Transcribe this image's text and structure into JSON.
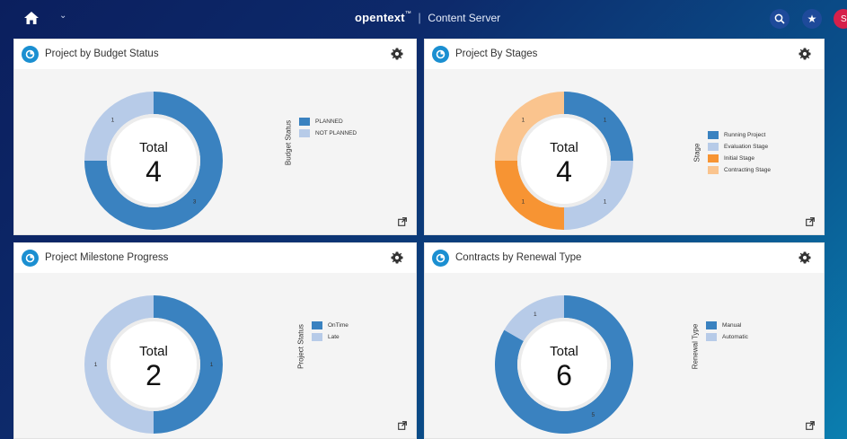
{
  "header": {
    "brand_name": "opentext",
    "brand_tm": "™",
    "separator": "|",
    "product": "Content Server",
    "avatar_initial": "S"
  },
  "icons": {
    "home": "home-icon",
    "chevron": "chevron-down-icon",
    "search": "search-icon",
    "favorites": "star-icon",
    "settings": "gear-icon",
    "open": "open-in-new-icon",
    "tile": "chart-tile-icon"
  },
  "colors": {
    "dark_blue": "#3a82c0",
    "light_blue": "#b7cbe8",
    "orange": "#f79433",
    "light_orange": "#fac48e",
    "header_bg": "#0d2a6b",
    "avatar": "#d6204a"
  },
  "tiles": [
    {
      "title": "Project by Budget Status",
      "total_label": "Total",
      "total": "4",
      "legend_title": "Budget Status",
      "legend": [
        "PLANNED",
        "NOT PLANNED"
      ]
    },
    {
      "title": "Project By Stages",
      "total_label": "Total",
      "total": "4",
      "legend_title": "Stage",
      "legend": [
        "Running Project",
        "Evaluation Stage",
        "Initial Stage",
        "Contracting Stage"
      ]
    },
    {
      "title": "Project Milestone Progress",
      "total_label": "Total",
      "total": "2",
      "legend_title": "Project Status",
      "legend": [
        "OnTime",
        "Late"
      ]
    },
    {
      "title": "Contracts by Renewal Type",
      "total_label": "Total",
      "total": "6",
      "legend_title": "Renewal Type",
      "legend": [
        "Manual",
        "Automatic"
      ]
    }
  ],
  "chart_data": [
    {
      "type": "pie",
      "title": "Project by Budget Status",
      "categories": [
        "PLANNED",
        "NOT PLANNED"
      ],
      "values": [
        3,
        1
      ],
      "colors": [
        "#3a82c0",
        "#b7cbe8"
      ]
    },
    {
      "type": "pie",
      "title": "Project By Stages",
      "categories": [
        "Running Project",
        "Evaluation Stage",
        "Initial Stage",
        "Contracting Stage"
      ],
      "values": [
        1,
        1,
        1,
        1
      ],
      "colors": [
        "#3a82c0",
        "#b7cbe8",
        "#f79433",
        "#fac48e"
      ]
    },
    {
      "type": "pie",
      "title": "Project Milestone Progress",
      "categories": [
        "OnTime",
        "Late"
      ],
      "values": [
        1,
        1
      ],
      "colors": [
        "#3a82c0",
        "#b7cbe8"
      ]
    },
    {
      "type": "pie",
      "title": "Contracts by Renewal Type",
      "categories": [
        "Manual",
        "Automatic"
      ],
      "values": [
        5,
        1
      ],
      "colors": [
        "#3a82c0",
        "#b7cbe8"
      ]
    }
  ]
}
